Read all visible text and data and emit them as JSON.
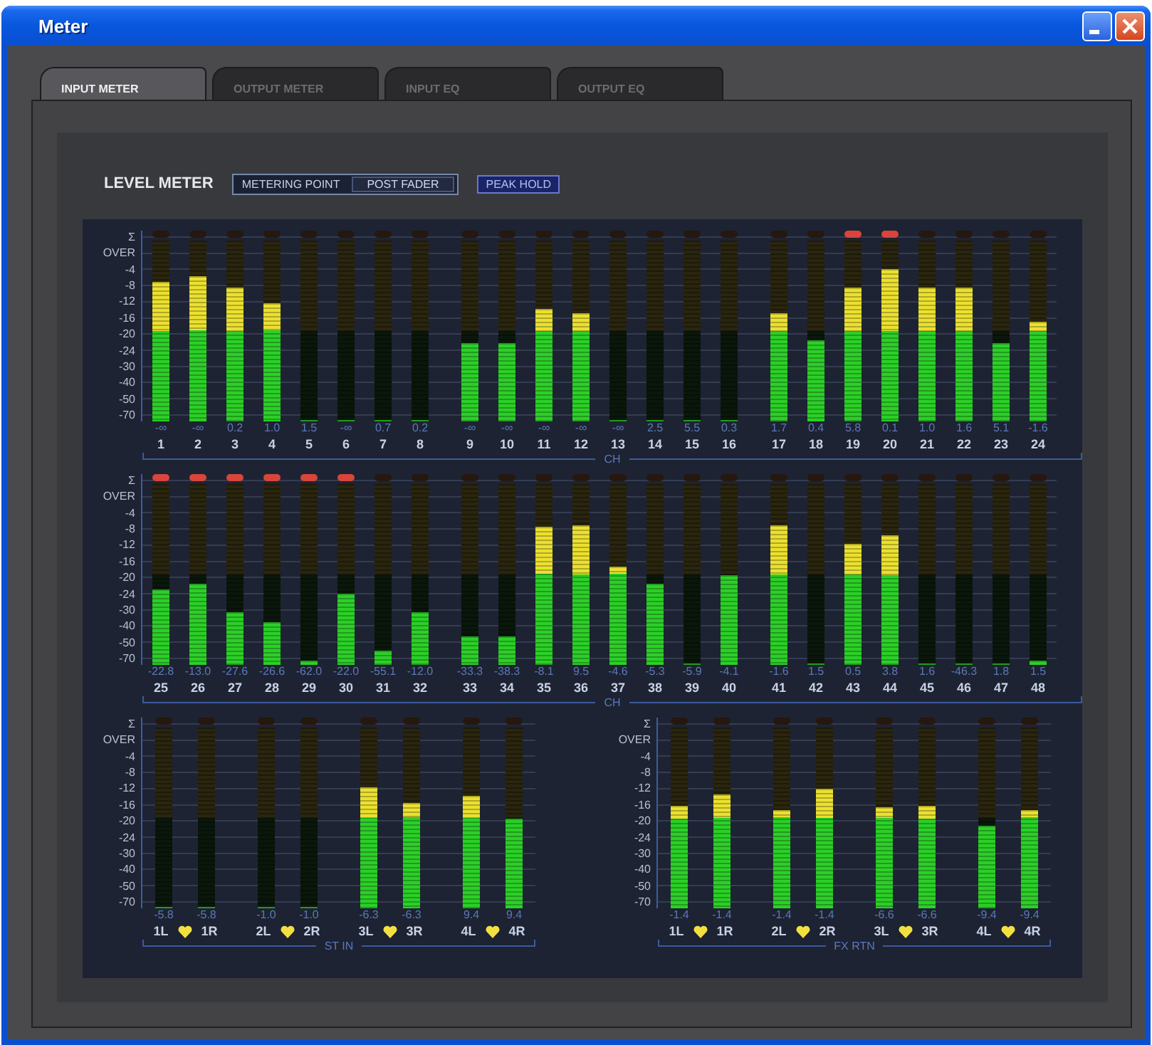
{
  "window": {
    "title": "Meter"
  },
  "tabs": [
    {
      "label": "INPUT METER",
      "selected": true
    },
    {
      "label": "OUTPUT METER",
      "selected": false
    },
    {
      "label": "INPUT EQ",
      "selected": false
    },
    {
      "label": "OUTPUT EQ",
      "selected": false
    }
  ],
  "level_meter": {
    "title": "LEVEL METER",
    "metering_point": {
      "label": "METERING POINT",
      "value": "POST FADER"
    },
    "peak_hold": {
      "label": "PEAK HOLD"
    }
  },
  "channel_rows": [
    {
      "group_label": "CH",
      "scale": [
        "Σ",
        "OVER",
        "-4",
        "-8",
        "-12",
        "-16",
        "-20",
        "-24",
        "-30",
        "-40",
        "-50",
        "-70"
      ],
      "meters": [
        {
          "reading": "-∞",
          "label": "1",
          "level": 0.77,
          "clip": false
        },
        {
          "reading": "-∞",
          "label": "2",
          "level": 0.8,
          "clip": false
        },
        {
          "reading": "0.2",
          "label": "3",
          "level": 0.74,
          "clip": false
        },
        {
          "reading": "1.0",
          "label": "4",
          "level": 0.65,
          "clip": false
        },
        {
          "reading": "1.5",
          "label": "5",
          "level": 0,
          "clip": false
        },
        {
          "reading": "-∞",
          "label": "6",
          "level": 0,
          "clip": false
        },
        {
          "reading": "0.7",
          "label": "7",
          "level": 0,
          "clip": false
        },
        {
          "reading": "0.2",
          "label": "8",
          "level": 0,
          "clip": false
        },
        {
          "reading": "-∞",
          "label": "9",
          "level": 0.43,
          "clip": false
        },
        {
          "reading": "-∞",
          "label": "10",
          "level": 0.43,
          "clip": false
        },
        {
          "reading": "-∞",
          "label": "11",
          "level": 0.62,
          "clip": false
        },
        {
          "reading": "-∞",
          "label": "12",
          "level": 0.6,
          "clip": false
        },
        {
          "reading": "-∞",
          "label": "13",
          "level": 0,
          "clip": false
        },
        {
          "reading": "2.5",
          "label": "14",
          "level": 0,
          "clip": false
        },
        {
          "reading": "5.5",
          "label": "15",
          "level": 0,
          "clip": false
        },
        {
          "reading": "0.3",
          "label": "16",
          "level": 0,
          "clip": false
        },
        {
          "reading": "1.7",
          "label": "17",
          "level": 0.6,
          "clip": false
        },
        {
          "reading": "0.4",
          "label": "18",
          "level": 0.45,
          "clip": false
        },
        {
          "reading": "5.8",
          "label": "19",
          "level": 0.74,
          "clip": true
        },
        {
          "reading": "0.1",
          "label": "20",
          "level": 0.84,
          "clip": true
        },
        {
          "reading": "1.0",
          "label": "21",
          "level": 0.74,
          "clip": false
        },
        {
          "reading": "1.6",
          "label": "22",
          "level": 0.74,
          "clip": false
        },
        {
          "reading": "5.1",
          "label": "23",
          "level": 0.43,
          "clip": false
        },
        {
          "reading": "-1.6",
          "label": "24",
          "level": 0.55,
          "clip": false
        }
      ]
    },
    {
      "group_label": "CH",
      "scale": [
        "Σ",
        "OVER",
        "-4",
        "-8",
        "-12",
        "-16",
        "-20",
        "-24",
        "-30",
        "-40",
        "-50",
        "-70"
      ],
      "meters": [
        {
          "reading": "-22.8",
          "label": "25",
          "level": 0.42,
          "clip": true
        },
        {
          "reading": "-13.0",
          "label": "26",
          "level": 0.45,
          "clip": true
        },
        {
          "reading": "-27.6",
          "label": "27",
          "level": 0.29,
          "clip": true
        },
        {
          "reading": "-26.6",
          "label": "28",
          "level": 0.24,
          "clip": true
        },
        {
          "reading": "-62.0",
          "label": "29",
          "level": 0.02,
          "clip": true
        },
        {
          "reading": "-22.0",
          "label": "30",
          "level": 0.39,
          "clip": true
        },
        {
          "reading": "-55.1",
          "label": "31",
          "level": 0.08,
          "clip": false
        },
        {
          "reading": "-12.0",
          "label": "32",
          "level": 0.29,
          "clip": false
        },
        {
          "reading": "-33.3",
          "label": "33",
          "level": 0.16,
          "clip": false
        },
        {
          "reading": "-38.3",
          "label": "34",
          "level": 0.16,
          "clip": false
        },
        {
          "reading": "-8.1",
          "label": "35",
          "level": 0.76,
          "clip": false
        },
        {
          "reading": "9.5",
          "label": "36",
          "level": 0.77,
          "clip": false
        },
        {
          "reading": "-4.6",
          "label": "37",
          "level": 0.54,
          "clip": false
        },
        {
          "reading": "-5.3",
          "label": "38",
          "level": 0.45,
          "clip": false
        },
        {
          "reading": "-5.9",
          "label": "39",
          "level": 0,
          "clip": false
        },
        {
          "reading": "-4.1",
          "label": "40",
          "level": 0.5,
          "clip": false
        },
        {
          "reading": "-1.6",
          "label": "41",
          "level": 0.77,
          "clip": false
        },
        {
          "reading": "1.5",
          "label": "42",
          "level": 0,
          "clip": false
        },
        {
          "reading": "0.5",
          "label": "43",
          "level": 0.67,
          "clip": false
        },
        {
          "reading": "3.8",
          "label": "44",
          "level": 0.72,
          "clip": false
        },
        {
          "reading": "1.6",
          "label": "45",
          "level": 0,
          "clip": false
        },
        {
          "reading": "-46.3",
          "label": "46",
          "level": 0,
          "clip": false
        },
        {
          "reading": "1.8",
          "label": "47",
          "level": 0,
          "clip": false
        },
        {
          "reading": "1.5",
          "label": "48",
          "level": 0.02,
          "clip": false
        }
      ]
    }
  ],
  "stereo_groups": [
    {
      "group_label": "ST IN",
      "scale": [
        "Σ",
        "OVER",
        "-4",
        "-8",
        "-12",
        "-16",
        "-20",
        "-24",
        "-30",
        "-40",
        "-50",
        "-70"
      ],
      "pairs": [
        {
          "linked": true,
          "meters": [
            {
              "reading": "-5.8",
              "label": "1L",
              "level": 0,
              "clip": false
            },
            {
              "reading": "-5.8",
              "label": "1R",
              "level": 0,
              "clip": false
            }
          ]
        },
        {
          "linked": true,
          "meters": [
            {
              "reading": "-1.0",
              "label": "2L",
              "level": 0,
              "clip": false
            },
            {
              "reading": "-1.0",
              "label": "2R",
              "level": 0,
              "clip": false
            }
          ]
        },
        {
          "linked": true,
          "meters": [
            {
              "reading": "-6.3",
              "label": "3L",
              "level": 0.67,
              "clip": false
            },
            {
              "reading": "-6.3",
              "label": "3R",
              "level": 0.58,
              "clip": false
            }
          ]
        },
        {
          "linked": true,
          "meters": [
            {
              "reading": "9.4",
              "label": "4L",
              "level": 0.62,
              "clip": false
            },
            {
              "reading": "9.4",
              "label": "4R",
              "level": 0.5,
              "clip": false
            }
          ]
        }
      ]
    },
    {
      "group_label": "FX RTN",
      "scale": [
        "Σ",
        "OVER",
        "-4",
        "-8",
        "-12",
        "-16",
        "-20",
        "-24",
        "-30",
        "-40",
        "-50",
        "-70"
      ],
      "pairs": [
        {
          "linked": true,
          "meters": [
            {
              "reading": "-1.4",
              "label": "1L",
              "level": 0.57,
              "clip": false
            },
            {
              "reading": "-1.4",
              "label": "1R",
              "level": 0.63,
              "clip": false
            }
          ]
        },
        {
          "linked": true,
          "meters": [
            {
              "reading": "-1.4",
              "label": "2L",
              "level": 0.54,
              "clip": false
            },
            {
              "reading": "-1.4",
              "label": "2R",
              "level": 0.66,
              "clip": false
            }
          ]
        },
        {
          "linked": true,
          "meters": [
            {
              "reading": "-6.6",
              "label": "3L",
              "level": 0.56,
              "clip": false
            },
            {
              "reading": "-6.6",
              "label": "3R",
              "level": 0.57,
              "clip": false
            }
          ]
        },
        {
          "linked": true,
          "meters": [
            {
              "reading": "-9.4",
              "label": "4L",
              "level": 0.46,
              "clip": false
            },
            {
              "reading": "-9.4",
              "label": "4R",
              "level": 0.54,
              "clip": false
            }
          ]
        }
      ]
    }
  ]
}
